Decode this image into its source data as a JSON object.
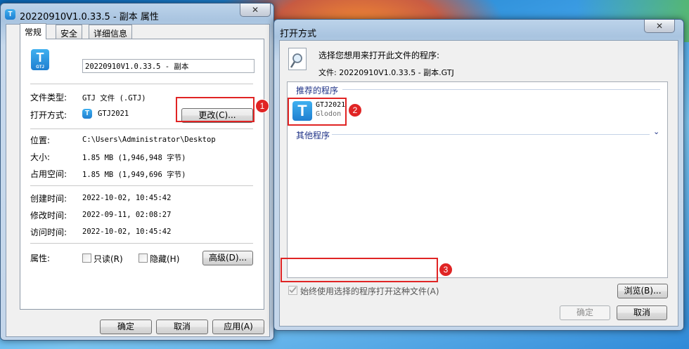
{
  "properties_window": {
    "title": "20220910V1.0.33.5 - 副本 属性",
    "close_label": "✕",
    "tabs": [
      "常规",
      "安全",
      "详细信息"
    ],
    "file_name": "20220910V1.0.33.5 - 副本",
    "file_icon_label": "GTJ",
    "rows": {
      "type_label": "文件类型:",
      "type_value": "GTJ 文件 (.GTJ)",
      "open_with_label": "打开方式:",
      "open_with_value": "GTJ2021",
      "change_button": "更改(C)...",
      "location_label": "位置:",
      "location_value": "C:\\Users\\Administrator\\Desktop",
      "size_label": "大小:",
      "size_value": "1.85 MB (1,946,948 字节)",
      "disk_size_label": "占用空间:",
      "disk_size_value": "1.85 MB (1,949,696 字节)",
      "created_label": "创建时间:",
      "created_value": "2022-10-02, 10:45:42",
      "modified_label": "修改时间:",
      "modified_value": "2022-09-11, 02:08:27",
      "accessed_label": "访问时间:",
      "accessed_value": "2022-10-02, 10:45:42",
      "attributes_label": "属性:",
      "readonly_label": "只读(R)",
      "hidden_label": "隐藏(H)",
      "advanced_button": "高级(D)..."
    },
    "buttons": {
      "ok": "确定",
      "cancel": "取消",
      "apply": "应用(A)"
    }
  },
  "open_with_dialog": {
    "title": "打开方式",
    "close_label": "✕",
    "prompt": "选择您想用来打开此文件的程序:",
    "file_label": "文件: 20220910V1.0.33.5 - 副本.GTJ",
    "recommended_header": "推荐的程序",
    "program_name": "GTJ2021",
    "program_vendor": "Glodon",
    "other_header": "其他程序",
    "always_use_label": "始终使用选择的程序打开这种文件(A)",
    "always_use_checked": true,
    "browse_button": "浏览(B)...",
    "ok_button": "确定",
    "cancel_button": "取消"
  },
  "annotations": {
    "badge1": "1",
    "badge2": "2",
    "badge3": "3",
    "highlight_color": "#e02424"
  }
}
